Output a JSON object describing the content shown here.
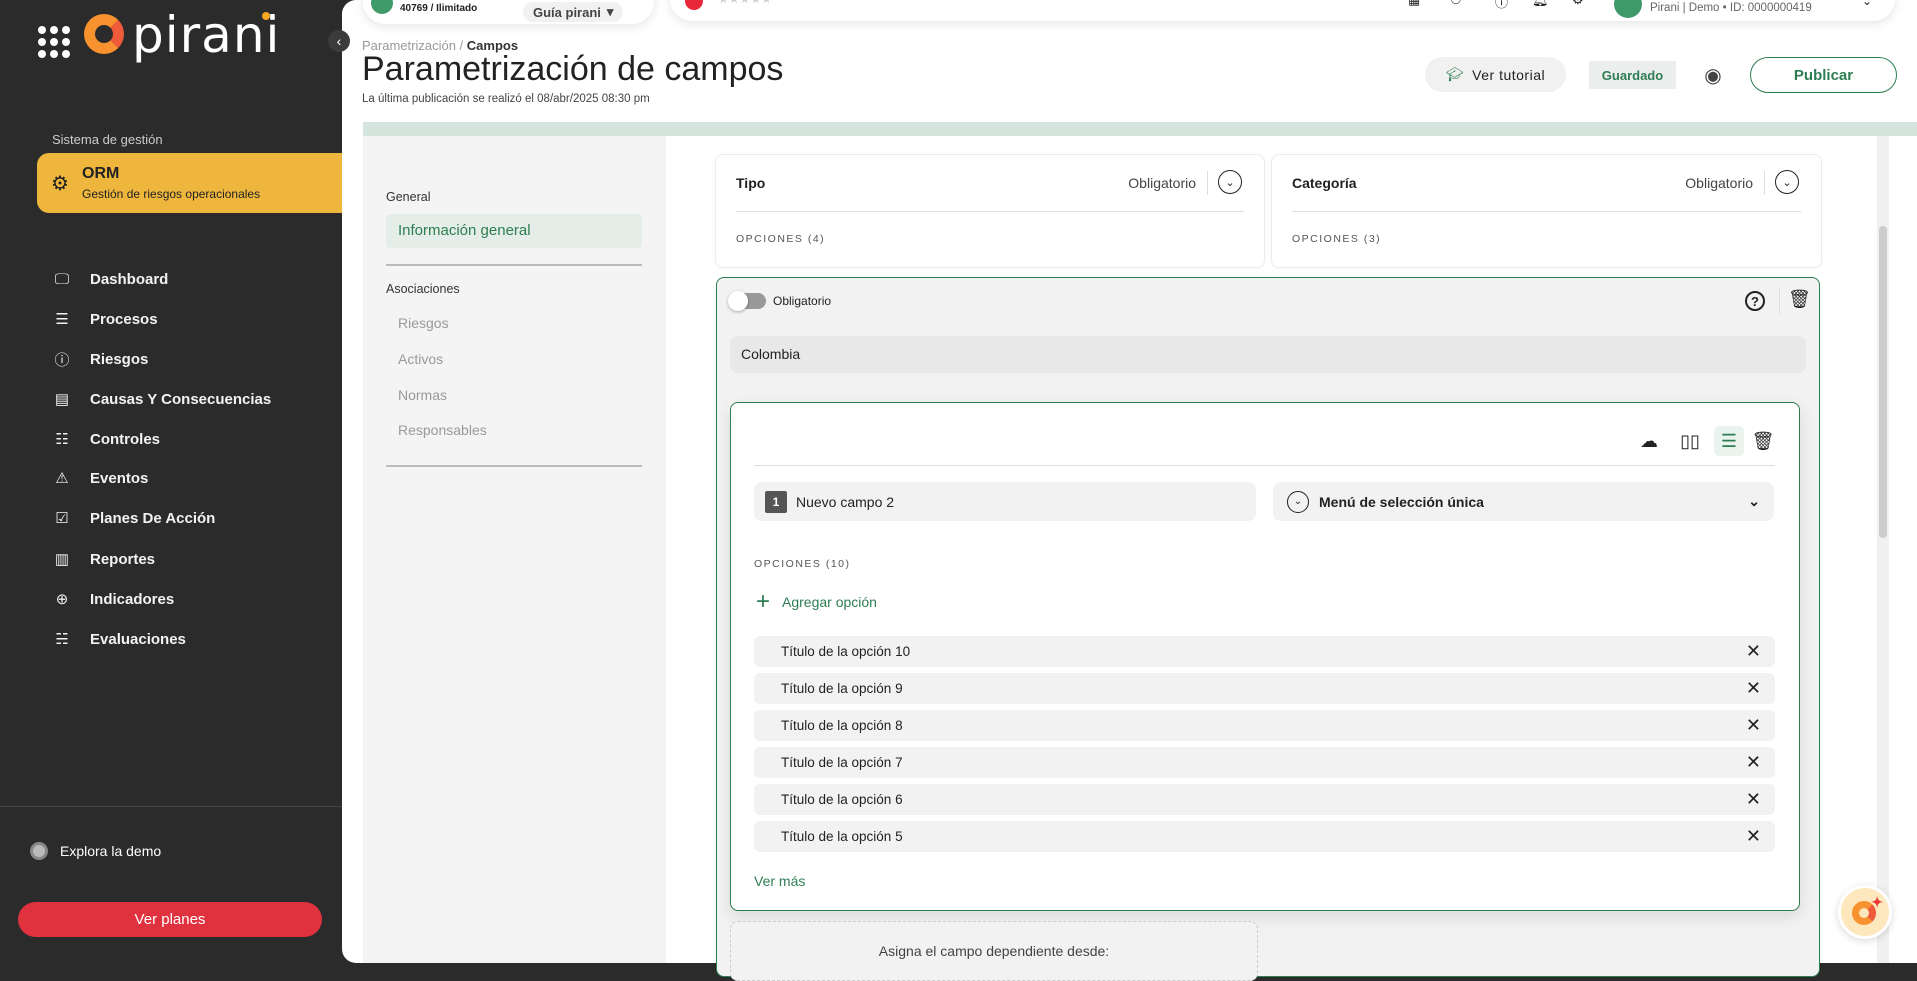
{
  "sidebar": {
    "logo": "pirani",
    "system_label": "Sistema de gestión",
    "module": {
      "code": "ORM",
      "name": "Gestión de riesgos operacionales"
    },
    "items": [
      {
        "label": "Dashboard",
        "icon": "monitor-icon"
      },
      {
        "label": "Procesos",
        "icon": "list-icon"
      },
      {
        "label": "Riesgos",
        "icon": "alert-circle-icon"
      },
      {
        "label": "Causas Y Consecuencias",
        "icon": "archive-icon"
      },
      {
        "label": "Controles",
        "icon": "sliders-icon"
      },
      {
        "label": "Eventos",
        "icon": "warning-triangle-icon"
      },
      {
        "label": "Planes De Acción",
        "icon": "clipboard-check-icon"
      },
      {
        "label": "Reportes",
        "icon": "bar-chart-icon"
      },
      {
        "label": "Indicadores",
        "icon": "crosshair-icon"
      },
      {
        "label": "Evaluaciones",
        "icon": "checklist-icon"
      }
    ],
    "explore": "Explora la demo",
    "plans_button": "Ver planes"
  },
  "topbar": {
    "usage": "40769 / Ilimitado",
    "guide": "Guía pirani",
    "account": "Pirani | Demo • ID: 0000000419"
  },
  "header": {
    "breadcrumb_parent": "Parametrización /",
    "breadcrumb_current": "Campos",
    "title": "Parametrización de campos",
    "subtitle": "La última publicación se realizó el 08/abr/2025 08:30 pm",
    "tutorial": "Ver tutorial",
    "status": "Guardado",
    "publish": "Publicar"
  },
  "leftnav": {
    "general": "General",
    "active": "Información general",
    "associations": "Asociaciones",
    "items": [
      "Riesgos",
      "Activos",
      "Normas",
      "Responsables"
    ]
  },
  "cards": [
    {
      "label": "Tipo",
      "value": "Obligatorio",
      "options": "OPCIONES (4)"
    },
    {
      "label": "Categoría",
      "value": "Obligatorio",
      "options": "OPCIONES (3)"
    }
  ],
  "field": {
    "toggle_label": "Obligatorio",
    "toggle_on": false,
    "country": "Colombia",
    "inner": {
      "number": "1",
      "name": "Nuevo campo 2",
      "type": "Menú de selección única",
      "options_label": "OPCIONES  (10)",
      "add": "Agregar opción",
      "options": [
        "Título de la opción 10",
        "Título de la opción 9",
        "Título de la opción 8",
        "Título de la opción 7",
        "Título de la opción 6",
        "Título de la opción 5"
      ],
      "more": "Ver más"
    },
    "dependent": "Asigna el campo dependiente desde:"
  },
  "colors": {
    "accent": "#2e7d52",
    "module": "#eeb63d",
    "danger": "#e0313f",
    "sidebar": "#2b2b2b"
  }
}
